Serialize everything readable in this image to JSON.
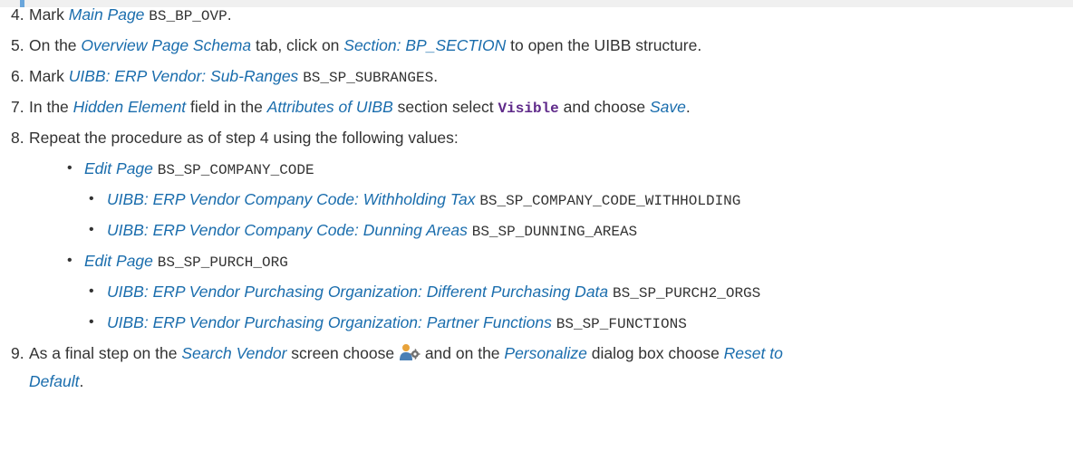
{
  "steps": [
    {
      "num": "4.",
      "parts": [
        {
          "t": "Mark "
        },
        {
          "t": "Main Page",
          "em": true
        },
        {
          "t": " "
        },
        {
          "t": "BS_BP_OVP",
          "mono": true
        },
        {
          "t": "."
        }
      ]
    },
    {
      "num": "5.",
      "parts": [
        {
          "t": "On the "
        },
        {
          "t": "Overview Page Schema",
          "em": true
        },
        {
          "t": " tab, click on "
        },
        {
          "t": "Section: BP_SECTION",
          "em": true
        },
        {
          "t": " to open the UIBB structure."
        }
      ]
    },
    {
      "num": "6.",
      "parts": [
        {
          "t": "Mark "
        },
        {
          "t": "UIBB: ERP Vendor: Sub-Ranges",
          "em": true
        },
        {
          "t": " "
        },
        {
          "t": "BS_SP_SUBRANGES",
          "mono": true
        },
        {
          "t": "."
        }
      ]
    },
    {
      "num": "7.",
      "parts": [
        {
          "t": "In the "
        },
        {
          "t": "Hidden Element",
          "em": true
        },
        {
          "t": " field in the "
        },
        {
          "t": "Attributes of UIBB",
          "em": true
        },
        {
          "t": " section select "
        },
        {
          "t": "Visible",
          "kw": true
        },
        {
          "t": " and choose "
        },
        {
          "t": "Save",
          "em": true
        },
        {
          "t": "."
        }
      ]
    },
    {
      "num": "8.",
      "parts": [
        {
          "t": "Repeat the procedure as of step 4 using the following values:"
        }
      ]
    }
  ],
  "bullets": [
    {
      "level": 1,
      "parts": [
        {
          "t": "Edit Page",
          "em": true
        },
        {
          "t": " "
        },
        {
          "t": "BS_SP_COMPANY_CODE",
          "mono": true
        }
      ]
    },
    {
      "level": 2,
      "parts": [
        {
          "t": "UIBB: ERP Vendor Company Code: Withholding Tax",
          "em": true
        },
        {
          "t": " "
        },
        {
          "t": "BS_SP_COMPANY_CODE_WITHHOLDING",
          "mono": true
        }
      ]
    },
    {
      "level": 2,
      "parts": [
        {
          "t": "UIBB: ERP Vendor Company Code: Dunning Areas",
          "em": true
        },
        {
          "t": " "
        },
        {
          "t": "BS_SP_DUNNING_AREAS",
          "mono": true
        }
      ]
    },
    {
      "level": 1,
      "parts": [
        {
          "t": "Edit Page",
          "em": true
        },
        {
          "t": " "
        },
        {
          "t": "BS_SP_PURCH_ORG",
          "mono": true
        }
      ]
    },
    {
      "level": 2,
      "parts": [
        {
          "t": "UIBB: ERP Vendor Purchasing Organization: Different Purchasing Data",
          "em": true
        },
        {
          "t": " "
        },
        {
          "t": "BS_SP_PURCH2_ORGS",
          "mono": true
        }
      ]
    },
    {
      "level": 2,
      "parts": [
        {
          "t": "UIBB: ERP Vendor Purchasing Organization: Partner Functions",
          "em": true
        },
        {
          "t": " "
        },
        {
          "t": "BS_SP_FUNCTIONS",
          "mono": true
        }
      ]
    }
  ],
  "bullet_char": "•",
  "step9": {
    "num": "9.",
    "line1": [
      {
        "t": "As a final step on the "
      },
      {
        "t": "Search Vendor",
        "em": true
      },
      {
        "t": " screen choose "
      },
      {
        "icon": "personalize-icon"
      },
      {
        "t": " and on the "
      },
      {
        "t": "Personalize",
        "em": true
      },
      {
        "t": " dialog box choose "
      },
      {
        "t": "Reset to",
        "em": true
      }
    ],
    "line2": [
      {
        "t": "Default",
        "em": true
      },
      {
        "t": "."
      }
    ]
  }
}
